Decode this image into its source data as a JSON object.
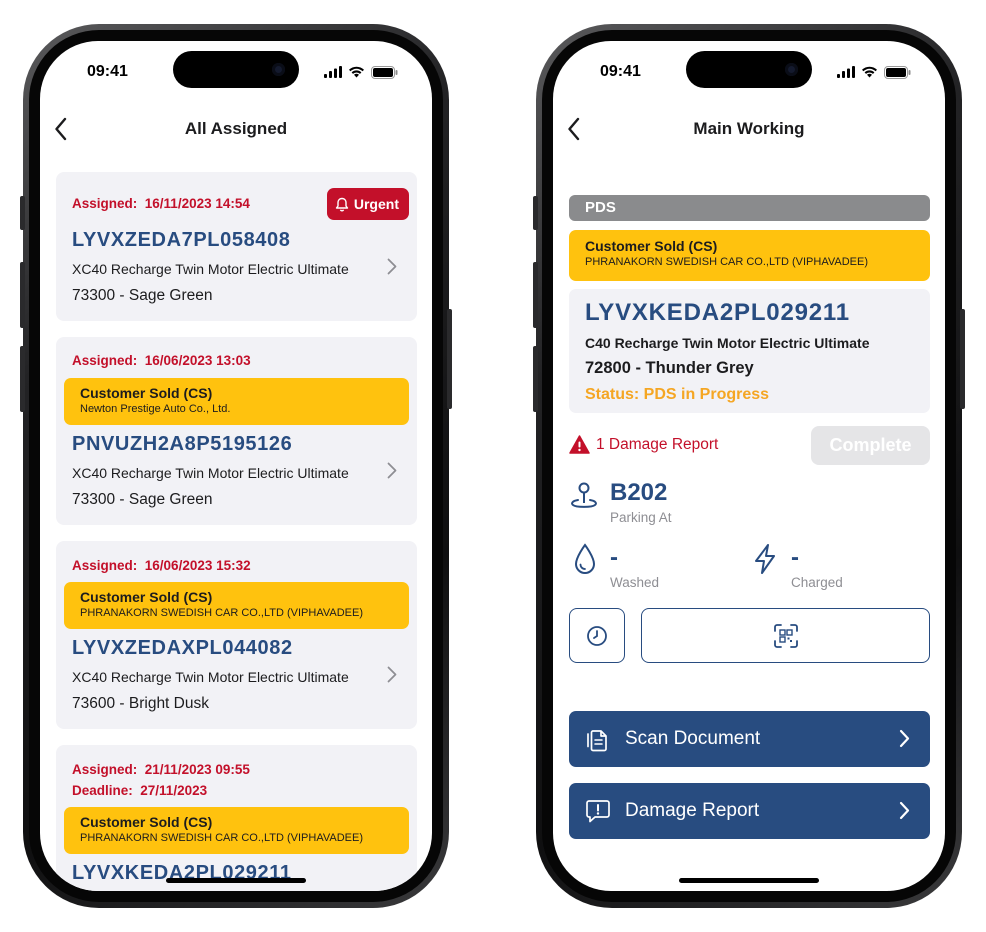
{
  "status_bar": {
    "time": "09:41"
  },
  "left_screen": {
    "title": "All Assigned",
    "assigned_label": "Assigned:",
    "deadline_label": "Deadline:",
    "urgent_label": "Urgent",
    "cards": [
      {
        "assigned": "16/11/2023 14:54",
        "urgent": true,
        "vin": "LYVXZEDA7PL058408",
        "model": "XC40 Recharge Twin Motor Electric Ultimate",
        "color": "73300 - Sage Green"
      },
      {
        "assigned": "16/06/2023 13:03",
        "customer_type": "Customer Sold (CS)",
        "dealer": "Newton Prestige Auto Co., Ltd.",
        "vin": "PNVUZH2A8P5195126",
        "model": "XC40 Recharge Twin Motor Electric Ultimate",
        "color": "73300 - Sage Green"
      },
      {
        "assigned": "16/06/2023 15:32",
        "customer_type": "Customer Sold (CS)",
        "dealer": "PHRANAKORN SWEDISH CAR CO.,LTD (VIPHAVADEE)",
        "vin": "LYVXZEDAXPL044082",
        "model": "XC40 Recharge Twin Motor Electric Ultimate",
        "color": "73600 - Bright Dusk"
      },
      {
        "assigned": "21/11/2023 09:55",
        "deadline": "27/11/2023",
        "customer_type": "Customer Sold (CS)",
        "dealer": "PHRANAKORN SWEDISH CAR CO.,LTD (VIPHAVADEE)",
        "vin": "LYVXKEDA2PL029211"
      }
    ]
  },
  "right_screen": {
    "title": "Main Working",
    "section": "PDS",
    "customer_type": "Customer Sold (CS)",
    "dealer": "PHRANAKORN SWEDISH CAR CO.,LTD (VIPHAVADEE)",
    "vin": "LYVXKEDA2PL029211",
    "model": "C40 Recharge Twin Motor Electric Ultimate",
    "color": "72800 - Thunder Grey",
    "status": "Status: PDS in Progress",
    "damage_count_text": "1 Damage Report",
    "complete_label": "Complete",
    "parking_value": "B202",
    "parking_label": "Parking At",
    "washed_value": "-",
    "washed_label": "Washed",
    "charged_value": "-",
    "charged_label": "Charged",
    "scan_document_label": "Scan Document",
    "damage_report_label": "Damage Report"
  },
  "colors": {
    "brand_blue": "#284c80",
    "alert_red": "#c3102a",
    "cs_yellow": "#ffc20e",
    "status_orange": "#f5a623",
    "card_bg": "#f2f2f6"
  }
}
